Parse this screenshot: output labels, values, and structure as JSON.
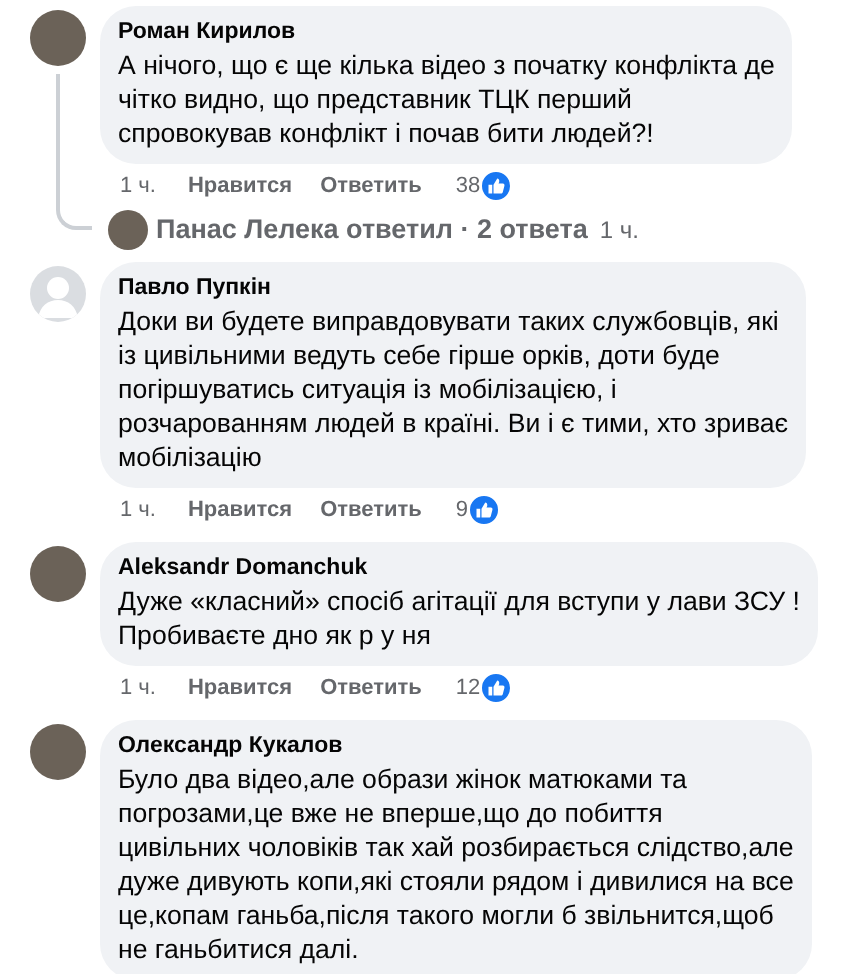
{
  "comments": [
    {
      "avatar": {
        "kind": "photo"
      },
      "author": "Роман Кирилов",
      "text": "А нічого, що є ще кілька відео з початку конфлікта де\nчітко видно, що представник ТЦК перший\nспровокував конфлікт і почав бити людей?!",
      "time": "1 ч.",
      "like": "Нравится",
      "reply": "Ответить",
      "reactions": "38",
      "replies": {
        "text": "Панас Лелека ответил · 2 ответа",
        "time": "1 ч."
      }
    },
    {
      "avatar": {
        "kind": "default"
      },
      "author": "Павло Пупкін",
      "text": "Доки ви будете виправдовувати таких службовців, які\nіз цивільними ведуть себе гірше орків, доти буде\nпогіршуватись ситуація із мобілізацією, і\nрозчарованням людей в країні. Ви і є тими, хто зриває\nмобілізацію",
      "time": "1 ч.",
      "like": "Нравится",
      "reply": "Ответить",
      "reactions": "9"
    },
    {
      "avatar": {
        "kind": "photo"
      },
      "author": "Aleksandr Domanchuk",
      "text": "Дуже «класний» спосіб агітації для вступи у лави ЗСУ !\nПробиваєте дно як р у ня",
      "time": "1 ч.",
      "like": "Нравится",
      "reply": "Ответить",
      "reactions": "12"
    },
    {
      "avatar": {
        "kind": "photo"
      },
      "author": "Олександр Кукалов",
      "text": "Було два відео,але образи жінок матюками та\nпогрозами,це вже не вперше,що до побиття\nцивільних чоловіків так хай розбирається слідство,але\nдуже дивують копи,які стояли рядом і дивилися на все\nце,копам ганьба,після такого могли б звільнится,щоб\nне ганьбитися далі."
    }
  ]
}
